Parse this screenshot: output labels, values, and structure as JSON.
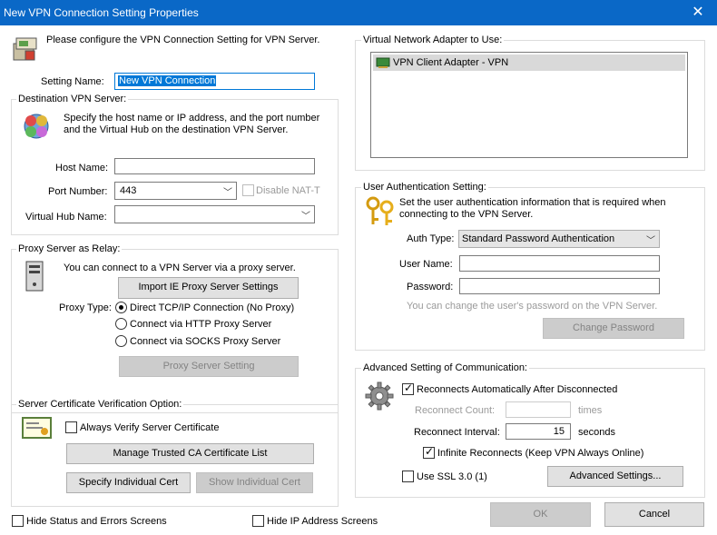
{
  "window": {
    "title": "New VPN Connection Setting Properties"
  },
  "header": {
    "intro": "Please configure the VPN Connection Setting for VPN Server."
  },
  "setting_name": {
    "label": "Setting Name:",
    "value": "New VPN Connection"
  },
  "destination": {
    "title": "Destination VPN Server:",
    "desc_line1": "Specify the host name or IP address, and the port number",
    "desc_line2": "and the Virtual Hub on the destination VPN Server.",
    "host_label": "Host Name:",
    "host_value": "",
    "port_label": "Port Number:",
    "port_value": "443",
    "disable_nat_label": "Disable NAT-T",
    "hub_label": "Virtual Hub Name:",
    "hub_value": ""
  },
  "proxy": {
    "title": "Proxy Server as Relay:",
    "desc": "You can connect to a VPN Server via a proxy server.",
    "import_button": "Import IE Proxy Server Settings",
    "type_label": "Proxy Type:",
    "options": [
      "Direct TCP/IP Connection (No Proxy)",
      "Connect via HTTP Proxy Server",
      "Connect via SOCKS Proxy Server"
    ],
    "selected": "Direct TCP/IP Connection (No Proxy)",
    "setting_button": "Proxy Server Setting"
  },
  "certificate": {
    "title": "Server Certificate Verification Option:",
    "always_verify_label": "Always Verify Server Certificate",
    "manage_ca_button": "Manage Trusted CA Certificate List",
    "specify_cert_button": "Specify Individual Cert",
    "show_cert_button": "Show Individual Cert"
  },
  "adapter": {
    "title": "Virtual Network Adapter to Use:",
    "items": [
      "VPN Client Adapter - VPN"
    ]
  },
  "auth": {
    "title": "User Authentication Setting:",
    "desc_line1": "Set the user authentication information that is required when",
    "desc_line2": "connecting to the VPN Server.",
    "type_label": "Auth Type:",
    "type_value": "Standard Password Authentication",
    "user_label": "User Name:",
    "user_value": "",
    "password_label": "Password:",
    "password_value": "",
    "hint": "You can change the user's password on the VPN Server.",
    "change_password_button": "Change Password"
  },
  "advanced": {
    "title": "Advanced Setting of Communication:",
    "reconnect_auto_label": "Reconnects Automatically After Disconnected",
    "reconnect_count_label": "Reconnect Count:",
    "reconnect_count_value": "",
    "times_label": "times",
    "interval_label": "Reconnect Interval:",
    "interval_value": "15",
    "seconds_label": "seconds",
    "infinite_label": "Infinite Reconnects (Keep VPN Always Online)",
    "ssl3_label": "Use SSL 3.0 (1)",
    "advanced_button": "Advanced Settings..."
  },
  "footer": {
    "hide_status_label": "Hide Status and Errors Screens",
    "hide_ip_label": "Hide IP Address Screens",
    "ok_button": "OK",
    "cancel_button": "Cancel"
  },
  "colors": {
    "titlebar": "#0a68c7",
    "selection": "#0078d7"
  }
}
